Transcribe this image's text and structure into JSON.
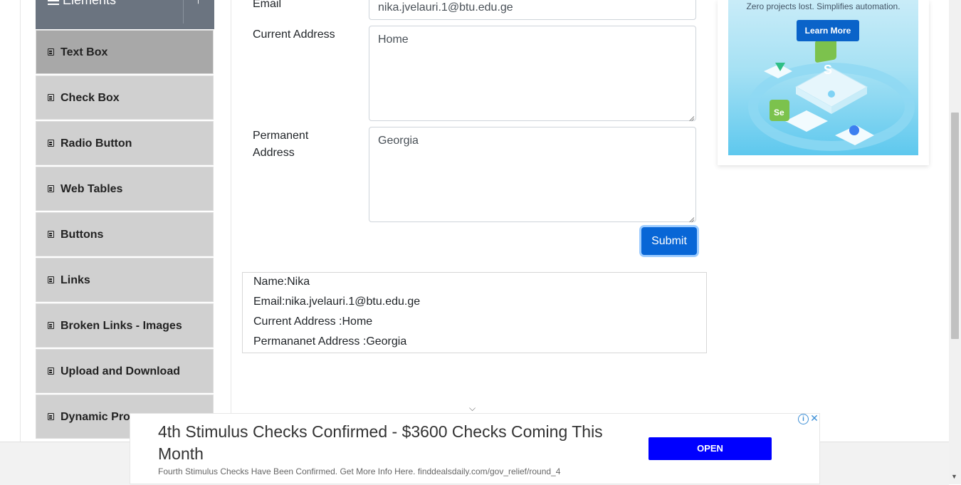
{
  "sidebar": {
    "group_title": "Elements",
    "items": [
      {
        "label": "Text Box",
        "active": true
      },
      {
        "label": "Check Box"
      },
      {
        "label": "Radio Button"
      },
      {
        "label": "Web Tables"
      },
      {
        "label": "Buttons"
      },
      {
        "label": "Links"
      },
      {
        "label": "Broken Links - Images"
      },
      {
        "label": "Upload and Download"
      },
      {
        "label": "Dynamic Prop"
      }
    ]
  },
  "form": {
    "email_label": "Email",
    "email_value": "nika.jvelauri.1@btu.edu.ge",
    "current_address_label": "Current Address",
    "current_address_value": "Home",
    "permanent_address_label_1": "Permanent",
    "permanent_address_label_2": "Address",
    "permanent_address_value": "Georgia",
    "submit_label": "Submit"
  },
  "output": {
    "name": "Name:Nika",
    "email": "Email:nika.jvelauri.1@btu.edu.ge",
    "current_address": "Current Address :Home",
    "permanent_address": "Permananet Address :Georgia"
  },
  "side_ad": {
    "tagline": "Zero projects lost. Simplifies automation.",
    "button_label": "Learn More"
  },
  "bottom_ad": {
    "headline": "4th Stimulus Checks Confirmed - $3600 Checks Coming This Month",
    "subline": "Fourth Stimulus Checks Have Been Confirmed. Get More Info Here. finddealsdaily.com/gov_relief/round_4",
    "button_label": "OPEN"
  },
  "colors": {
    "submit": "#0866d6",
    "sidebar_item": "#d0d0d0",
    "sidebar_active": "#a8a8a8",
    "group_header": "#6b7480",
    "ad_button": "#0000ff"
  }
}
